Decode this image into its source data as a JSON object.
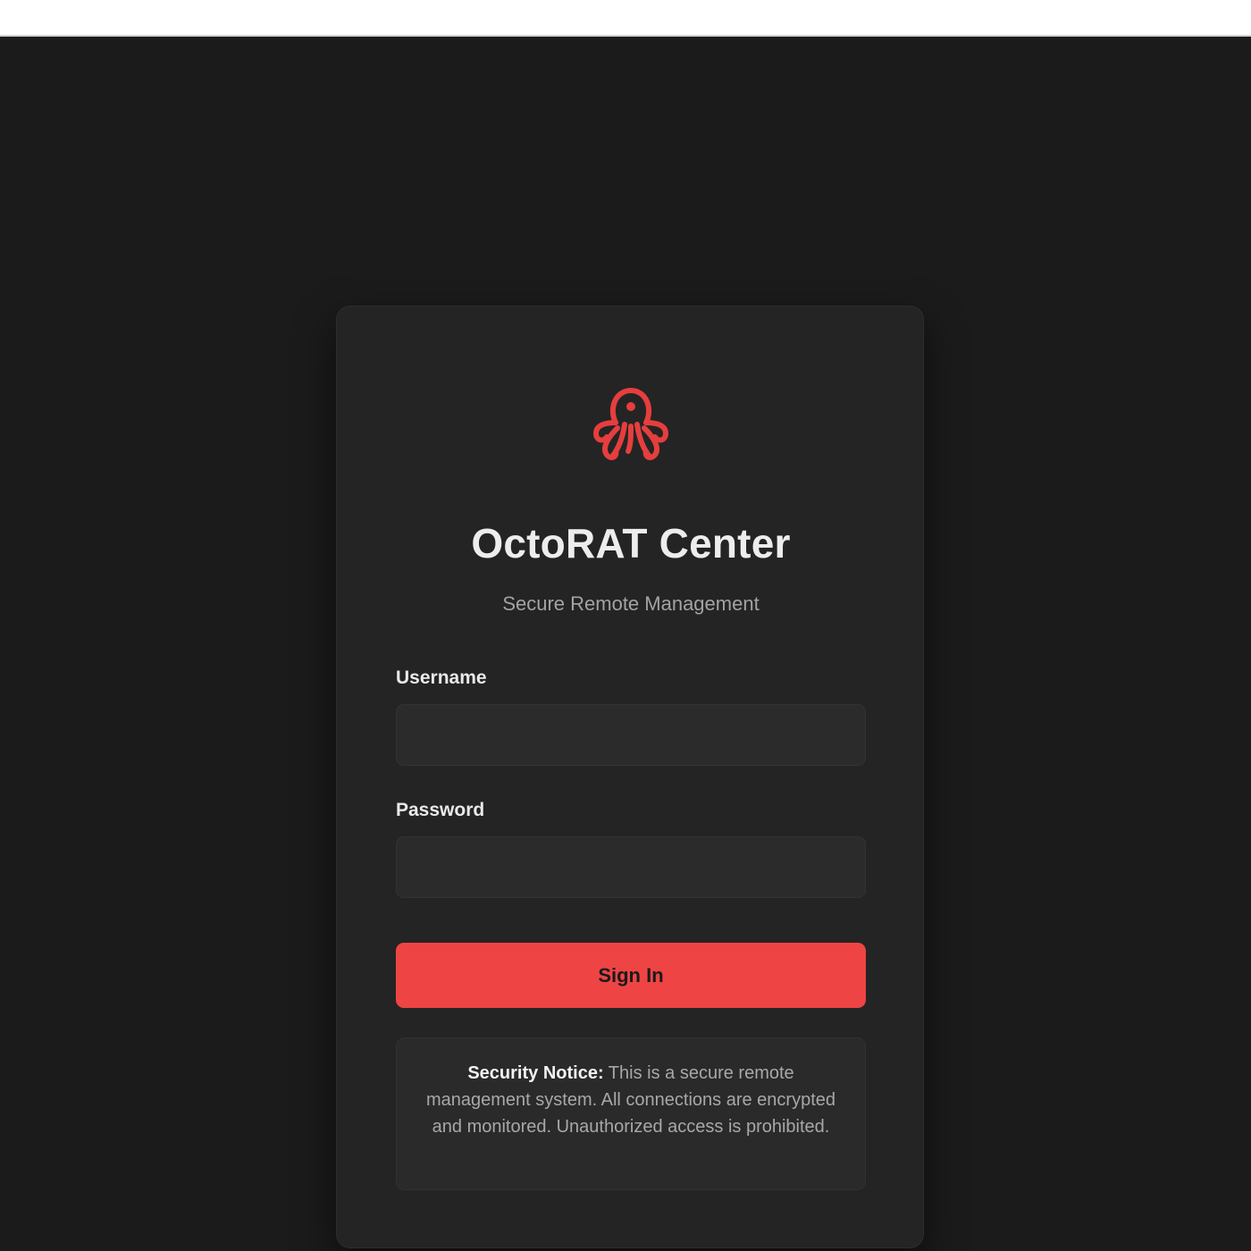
{
  "app": {
    "title": "OctoRAT Center",
    "subtitle": "Secure Remote Management",
    "logo_icon": "octopus-icon",
    "accent_color": "#ef4444"
  },
  "form": {
    "username": {
      "label": "Username",
      "value": "",
      "placeholder": ""
    },
    "password": {
      "label": "Password",
      "value": "",
      "placeholder": ""
    },
    "submit_label": "Sign In"
  },
  "notice": {
    "heading": "Security Notice:",
    "body": " This is a secure remote management system. All connections are encrypted and monitored. Unauthorized access is prohibited."
  }
}
